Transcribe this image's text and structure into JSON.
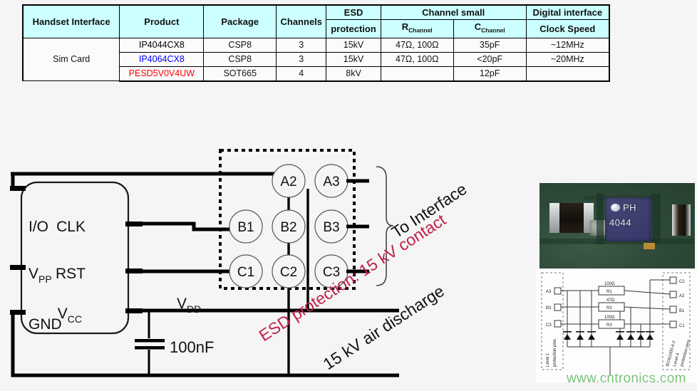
{
  "table": {
    "headers": {
      "handset_interface": "Handset Interface",
      "product": "Product",
      "package": "Package",
      "channels": "Channels",
      "esd_protection_l1": "ESD",
      "esd_protection_l2": "protection",
      "channel_small": "Channel small",
      "r_channel": "R",
      "r_channel_sub": "Channel",
      "c_channel": "C",
      "c_channel_sub": "Channel",
      "digital_interface": "Digital interface",
      "clock_speed": "Clock Speed"
    },
    "row_group_label": "Sim Card",
    "rows": [
      {
        "product": "IP4044CX8",
        "product_color": "#000000",
        "package": "CSP8",
        "channels": "3",
        "esd": "15kV",
        "r_channel": "47Ω, 100Ω",
        "c_channel": "35pF",
        "clock_speed": "~12MHz"
      },
      {
        "product": "IP4064CX8",
        "product_color": "#0000ff",
        "package": "CSP8",
        "channels": "3",
        "esd": "15kV",
        "r_channel": "47Ω, 100Ω",
        "c_channel": "<20pF",
        "clock_speed": "~20MHz"
      },
      {
        "product": "PESD5V0V4UW",
        "product_color": "#ff0000",
        "package": "SOT665",
        "channels": "4",
        "esd": "8kV",
        "r_channel": "",
        "c_channel": "12pF",
        "clock_speed": ""
      }
    ]
  },
  "diagram": {
    "sim_block": {
      "pins_left": [
        "I/O",
        "V",
        "GND"
      ],
      "pin_vpp_main": "V",
      "pin_vpp_sub": "PP",
      "pin_io": "I/O",
      "pin_gnd": "GND",
      "pin_clk": "CLK",
      "pin_rst": "RST",
      "pin_vcc_main": "V",
      "pin_vcc_sub": "CC"
    },
    "net_labels": {
      "vdd_main": "V",
      "vdd_sub": "DD",
      "cap_value": "100nF"
    },
    "balls": [
      "A2",
      "A3",
      "B1",
      "B2",
      "B3",
      "C1",
      "C2",
      "C3"
    ],
    "annotations": {
      "to_interface": "To Interface",
      "esd_contact": "ESD protection: 15 kV contact",
      "esd_air": "15 kV air discharge"
    },
    "colors": {
      "esd_red": "#c0214a",
      "wire": "#000000",
      "header_cyan": "#ccffff"
    }
  },
  "photo": {
    "chip_marking_line1": "PH",
    "chip_marking_line2": "4044"
  },
  "schematic": {
    "left_label_line1": "Level 1",
    "left_label_line2": "protection pins",
    "right_label_line1": "IEC61000-4-2",
    "right_label_line2": "Level 4",
    "right_label_line3": "protection pins",
    "left_pins": [
      "A3",
      "B3",
      "C3"
    ],
    "right_pins": [
      "C2",
      "A2",
      "B1",
      "C1"
    ],
    "resistors": [
      {
        "ref": "R1",
        "value": "100Ω"
      },
      {
        "ref": "R2",
        "value": "47Ω"
      },
      {
        "ref": "R3",
        "value": "100Ω"
      }
    ]
  },
  "watermark": "www.cntronics.com"
}
